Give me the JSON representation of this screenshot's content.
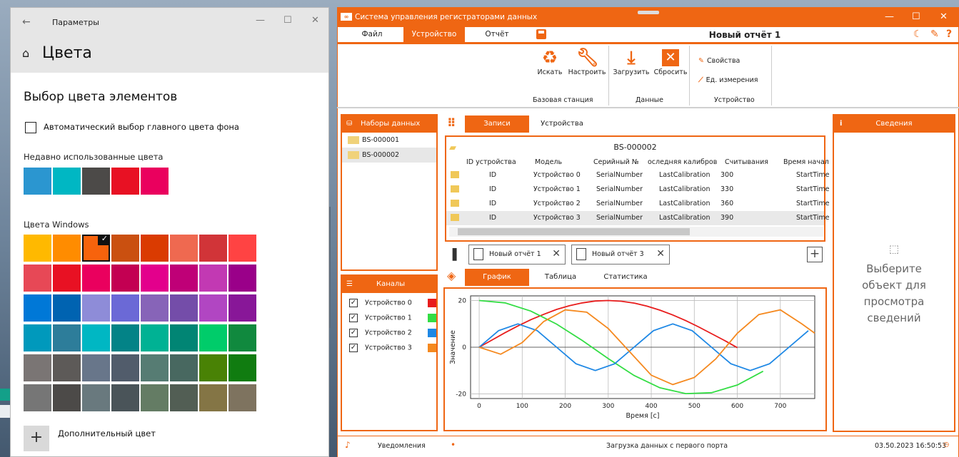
{
  "settings": {
    "title": "Параметры",
    "window_buttons": [
      "—",
      "☐",
      "✕"
    ],
    "back": "←",
    "page_title": "Цвета",
    "section_title": "Выбор цвета элементов",
    "auto_checkbox_label": "Автоматический выбор главного цвета фона",
    "recent_label": "Недавно использованные цвета",
    "recent_colors": [
      "#2b96d0",
      "#00b7c3",
      "#4c4a48",
      "#e81123",
      "#ea005e"
    ],
    "windows_label": "Цвета Windows",
    "windows_colors": [
      [
        "#ffb900",
        "#ff8c00",
        "#f7630c",
        "#ca5010",
        "#da3b01",
        "#ef6950",
        "#d13438",
        "#ff4343"
      ],
      [
        "#e74856",
        "#e81123",
        "#ea005e",
        "#c30052",
        "#e3008c",
        "#bf0077",
        "#c239b3",
        "#9a0089"
      ],
      [
        "#0078d7",
        "#0063b1",
        "#8e8cd8",
        "#6b69d6",
        "#8764b8",
        "#744da9",
        "#b146c2",
        "#881798"
      ],
      [
        "#0099bc",
        "#2d7d9a",
        "#00b7c3",
        "#038387",
        "#00b294",
        "#018574",
        "#00cc6a",
        "#10893e"
      ],
      [
        "#7a7574",
        "#5d5a58",
        "#68768a",
        "#515c6b",
        "#567c73",
        "#486860",
        "#498205",
        "#107c10"
      ],
      [
        "#767676",
        "#4c4a48",
        "#69797e",
        "#4a5459",
        "#647c64",
        "#525e54",
        "#847545",
        "#7e735f"
      ]
    ],
    "selected_color": "#f7630c",
    "more_label": "Дополнительный цвет"
  },
  "app": {
    "title": "Система управления регистраторами данных",
    "logo": "∞",
    "window_buttons": [
      "—",
      "☐",
      "✕"
    ],
    "menu": [
      "Файл",
      "Устройство",
      "Отчёт"
    ],
    "report_title": "Новый отчёт 1",
    "ribbon": {
      "search": "Искать",
      "configure": "Настроить",
      "base_group": "Базовая станция",
      "load": "Загрузить",
      "reset": "Сбросить",
      "data_group": "Данные",
      "properties": "Свойства",
      "units": "Ед. измерения",
      "device_group": "Устройство"
    },
    "datasets": {
      "title": "Наборы данных",
      "items": [
        "BS-000001",
        "BS-000002"
      ],
      "selected_index": 1
    },
    "channels": {
      "title": "Каналы",
      "items": [
        {
          "name": "Устройство 0",
          "color": "#e81c1c"
        },
        {
          "name": "Устройство 1",
          "color": "#33dd44"
        },
        {
          "name": "Устройство 2",
          "color": "#1e88e5"
        },
        {
          "name": "Устройство 3",
          "color": "#f5891f"
        }
      ]
    },
    "top_tabs": [
      "Записи",
      "Устройства"
    ],
    "table": {
      "title": "BS-000002",
      "headers": [
        "ID устройства",
        "Модель",
        "Серийный №",
        "оследняя калибров",
        "Считывания",
        "Время начал"
      ],
      "rows": [
        [
          "ID",
          "Устройство 0",
          "SerialNumber",
          "LastCalibration",
          "300",
          "StartTime"
        ],
        [
          "ID",
          "Устройство 1",
          "SerialNumber",
          "LastCalibration",
          "330",
          "StartTime"
        ],
        [
          "ID",
          "Устройство 2",
          "SerialNumber",
          "LastCalibration",
          "360",
          "StartTime"
        ],
        [
          "ID",
          "Устройство 3",
          "SerialNumber",
          "LastCalibration",
          "390",
          "StartTime"
        ]
      ],
      "selected_row": 3
    },
    "report_tabs": [
      "Новый отчёт 1",
      "Новый отчёт 3"
    ],
    "view_tabs": [
      "График",
      "Таблица",
      "Статистика"
    ],
    "info": {
      "title": "Сведения",
      "placeholder": "Выберите объект для просмотра сведений"
    },
    "status": {
      "notifications": "Уведомления",
      "message": "Загрузка данных с первого порта",
      "datetime": "03.50.2023 16:50:53"
    }
  },
  "chart_data": {
    "type": "line",
    "xlabel": "Время [с]",
    "ylabel": "Значение",
    "xlim": [
      -20,
      780
    ],
    "ylim": [
      -22,
      22
    ],
    "xticks": [
      0,
      100,
      200,
      300,
      400,
      500,
      600,
      700
    ],
    "yticks": [
      -20,
      0,
      20
    ],
    "series": [
      {
        "name": "Устройство 0",
        "color": "#e81c1c",
        "x": [
          0,
          30,
          60,
          90,
          120,
          150,
          180,
          210,
          240,
          270,
          300,
          330,
          360,
          390,
          420,
          450,
          480,
          510,
          540,
          570,
          600
        ],
        "y": [
          0,
          3.1,
          6.2,
          9.1,
          11.8,
          14.1,
          16.2,
          17.8,
          19.0,
          19.8,
          20.0,
          19.7,
          18.9,
          17.6,
          15.9,
          13.8,
          11.4,
          8.7,
          5.8,
          2.9,
          -0.2
        ]
      },
      {
        "name": "Устройство 1",
        "color": "#33dd44",
        "x": [
          0,
          60,
          120,
          180,
          240,
          300,
          360,
          420,
          480,
          540,
          600,
          660
        ],
        "y": [
          20,
          19.0,
          15.5,
          9.9,
          2.8,
          -4.9,
          -12.1,
          -17.4,
          -19.9,
          -19.5,
          -16.2,
          -10.3
        ]
      },
      {
        "name": "Устройство 2",
        "color": "#1e88e5",
        "x": [
          0,
          45,
          90,
          135,
          180,
          225,
          270,
          315,
          360,
          405,
          450,
          495,
          540,
          585,
          630,
          675,
          720,
          765
        ],
        "y": [
          0,
          7.1,
          10.0,
          7.1,
          0,
          -7.1,
          -10.0,
          -7.1,
          0,
          7.1,
          10.0,
          7.1,
          0,
          -7.1,
          -10.0,
          -7.1,
          0,
          7.1
        ]
      },
      {
        "name": "Устройство 3",
        "color": "#f5891f",
        "x": [
          0,
          50,
          100,
          150,
          200,
          250,
          300,
          350,
          400,
          450,
          500,
          550,
          600,
          650,
          700,
          750,
          780
        ],
        "y": [
          0,
          -3.0,
          2.0,
          11.0,
          16.0,
          15.0,
          8.0,
          -2.0,
          -12.0,
          -16.0,
          -13.0,
          -5.0,
          6.0,
          14.0,
          16.0,
          10.0,
          6.0
        ]
      }
    ]
  }
}
